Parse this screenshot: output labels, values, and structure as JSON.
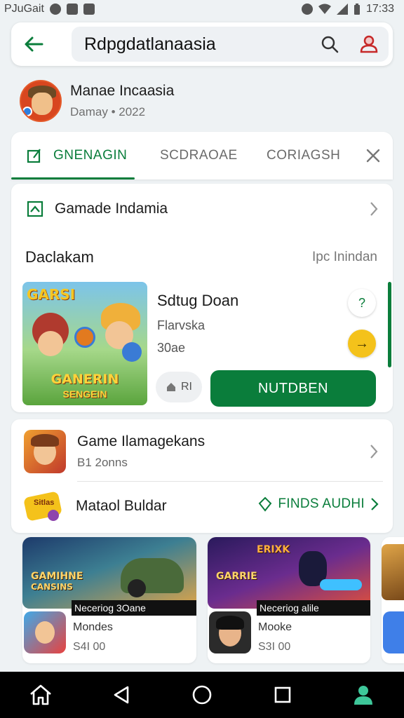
{
  "status_bar": {
    "left_text": "PJuGait",
    "time": "17:33"
  },
  "search": {
    "back_label": "back",
    "query": "Rdpgdatlanaasia"
  },
  "profile": {
    "name": "Manae Incaasia",
    "subtitle": "Damay • 2022"
  },
  "tabs": [
    {
      "label": "GNENAGIN",
      "active": true
    },
    {
      "label": "SCDRAOAE",
      "active": false
    },
    {
      "label": "CORIAGSH",
      "active": false
    }
  ],
  "section": {
    "title": "Gamade Indamia"
  },
  "daily": {
    "label": "Daclakam",
    "more": "Ipc Inindan"
  },
  "featured_app": {
    "banner_logo": "GARSI",
    "banner_title": "GANERIN",
    "banner_subtitle": "SENGEIN",
    "title": "Sdtug Doan",
    "meta1": "Flarvska",
    "meta2": "30ae",
    "chip_label": "RI",
    "install_label": "NUTDBEN"
  },
  "list": [
    {
      "title": "Game Ilamagekans",
      "subtitle": "B1 2onns"
    },
    {
      "title": "Mataol Buldar",
      "action": "FINDS AUDHI"
    }
  ],
  "thumb_text": "Sitlas",
  "games": [
    {
      "banner_text": "GAMIHNE",
      "banner_sub": "CANSINS",
      "caption": "Neceriog 3Oane",
      "name": "Mondes",
      "price": "S4I 00"
    },
    {
      "banner_text": "GARRIE",
      "banner_sub": "ERIXK",
      "caption": "Neceriog alile",
      "name": "Mooke",
      "price": "S3I 00"
    }
  ],
  "colors": {
    "accent": "#0a7d3b",
    "yellow": "#f4c21b",
    "background": "#eef2f4"
  }
}
